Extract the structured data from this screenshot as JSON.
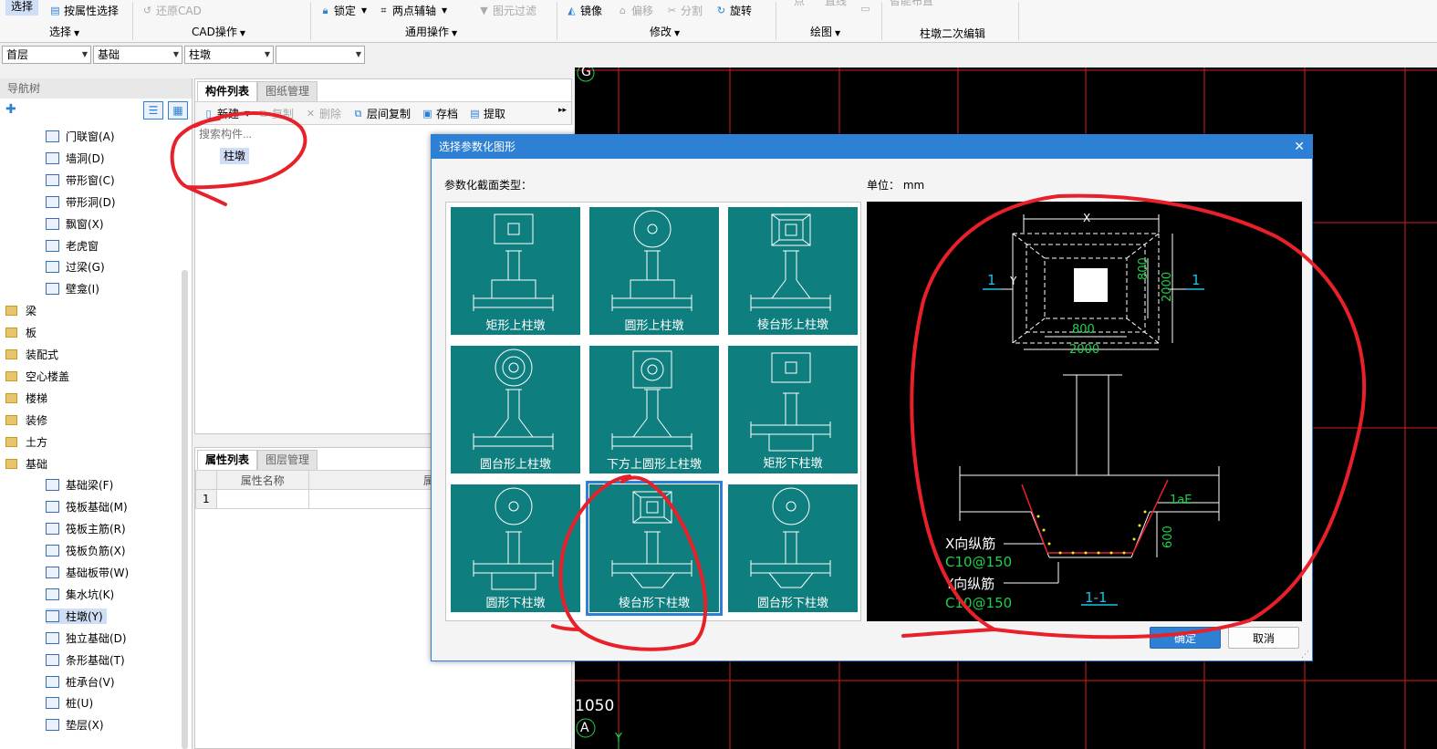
{
  "ribbon": {
    "items": [
      {
        "label": "选择"
      },
      {
        "label": "按属性选择"
      },
      {
        "label": "还原CAD"
      },
      {
        "label": "锁定"
      },
      {
        "label": "两点辅轴"
      },
      {
        "label": "图元过滤"
      },
      {
        "label": "镜像"
      },
      {
        "label": "偏移"
      },
      {
        "label": "分割"
      },
      {
        "label": "旋转"
      },
      {
        "label": "点"
      },
      {
        "label": "直线"
      },
      {
        "label": "智能布置"
      }
    ],
    "groups": [
      {
        "label": "选择"
      },
      {
        "label": "CAD操作"
      },
      {
        "label": "通用操作"
      },
      {
        "label": "修改"
      },
      {
        "label": "绘图"
      },
      {
        "label": "柱墩二次编辑"
      }
    ]
  },
  "combos": [
    "首层",
    "基础",
    "柱墩",
    ""
  ],
  "nav": {
    "title": "导航树",
    "items": [
      {
        "label": "门联窗(A)"
      },
      {
        "label": "墙洞(D)"
      },
      {
        "label": "带形窗(C)"
      },
      {
        "label": "带形洞(D)"
      },
      {
        "label": "飘窗(X)"
      },
      {
        "label": "老虎窗"
      },
      {
        "label": "过梁(G)"
      },
      {
        "label": "壁龛(I)"
      },
      {
        "label": "梁"
      },
      {
        "label": "板"
      },
      {
        "label": "装配式"
      },
      {
        "label": "空心楼盖"
      },
      {
        "label": "楼梯"
      },
      {
        "label": "装修"
      },
      {
        "label": "土方"
      },
      {
        "label": "基础"
      },
      {
        "label": "基础梁(F)"
      },
      {
        "label": "筏板基础(M)"
      },
      {
        "label": "筏板主筋(R)"
      },
      {
        "label": "筏板负筋(X)"
      },
      {
        "label": "基础板带(W)"
      },
      {
        "label": "集水坑(K)"
      },
      {
        "label": "柱墩(Y)"
      },
      {
        "label": "独立基础(D)"
      },
      {
        "label": "条形基础(T)"
      },
      {
        "label": "桩承台(V)"
      },
      {
        "label": "桩(U)"
      },
      {
        "label": "垫层(X)"
      }
    ]
  },
  "component_panel": {
    "tabs": [
      "构件列表",
      "图纸管理"
    ],
    "toolbar": [
      "新建",
      "复制",
      "删除",
      "层间复制",
      "存档",
      "提取"
    ],
    "search_placeholder": "搜索构件...",
    "items": [
      "柱墩"
    ]
  },
  "property_panel": {
    "tabs": [
      "属性列表",
      "图层管理"
    ],
    "columns": [
      "属性名称",
      "属性值"
    ],
    "rows": [
      {
        "index": "1"
      }
    ]
  },
  "cad": {
    "labels": {
      "axis_g": "G",
      "axis_a": "A",
      "dim": "1050",
      "axis_y": "Y"
    }
  },
  "dialog": {
    "title": "选择参数化图形",
    "type_label": "参数化截面类型：",
    "unit_label": "单位：  mm",
    "options": [
      {
        "label": "矩形上柱墩"
      },
      {
        "label": "圆形上柱墩"
      },
      {
        "label": "棱台形上柱墩"
      },
      {
        "label": "圆台形上柱墩"
      },
      {
        "label": "下方上圆形上柱墩"
      },
      {
        "label": "矩形下柱墩"
      },
      {
        "label": "圆形下柱墩"
      },
      {
        "label": "棱台形下柱墩",
        "selected": true
      },
      {
        "label": "圆台形下柱墩"
      }
    ],
    "preview": {
      "x": "X",
      "y": "Y",
      "section_mark": "1",
      "dim_800": "800",
      "dim_2000": "2000",
      "dim_lae": "1aE",
      "dim_600": "600",
      "x_bar_label": "X向纵筋",
      "x_bar_value": "C10@150",
      "y_bar_label": "Y向纵筋",
      "y_bar_value": "C10@150",
      "section_label": "1-1"
    },
    "ok": "确定",
    "cancel": "取消"
  },
  "colors": {
    "accent": "#2e80d5",
    "tile": "#0e7f7e",
    "annotation": "#e8202a",
    "cad_grid": "#d61f1f",
    "dim_green": "#1fd14a",
    "mark_cyan": "#19c3e6"
  }
}
